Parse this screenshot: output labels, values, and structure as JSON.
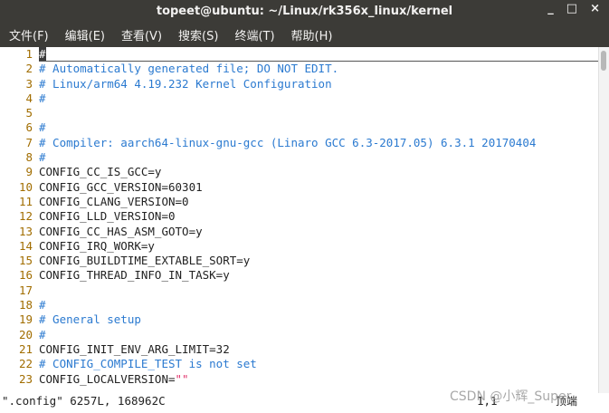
{
  "window": {
    "title": "topeet@ubuntu: ~/Linux/rk356x_linux/kernel",
    "controls": [
      "_",
      "□",
      "×"
    ]
  },
  "menu": [
    "文件(F)",
    "编辑(E)",
    "查看(V)",
    "搜索(S)",
    "终端(T)",
    "帮助(H)"
  ],
  "lines": [
    {
      "n": "1",
      "t": "#",
      "kind": "comment",
      "cursor": true
    },
    {
      "n": "2",
      "t": "# Automatically generated file; DO NOT EDIT.",
      "kind": "comment"
    },
    {
      "n": "3",
      "t": "# Linux/arm64 4.19.232 Kernel Configuration",
      "kind": "comment"
    },
    {
      "n": "4",
      "t": "#",
      "kind": "comment"
    },
    {
      "n": "5",
      "t": "",
      "kind": "code"
    },
    {
      "n": "6",
      "t": "#",
      "kind": "comment"
    },
    {
      "n": "7",
      "t": "# Compiler: aarch64-linux-gnu-gcc (Linaro GCC 6.3-2017.05) 6.3.1 20170404",
      "kind": "comment"
    },
    {
      "n": "8",
      "t": "#",
      "kind": "comment"
    },
    {
      "n": "9",
      "t": "CONFIG_CC_IS_GCC=y",
      "kind": "code"
    },
    {
      "n": "10",
      "t": "CONFIG_GCC_VERSION=60301",
      "kind": "code"
    },
    {
      "n": "11",
      "t": "CONFIG_CLANG_VERSION=0",
      "kind": "code"
    },
    {
      "n": "12",
      "t": "CONFIG_LLD_VERSION=0",
      "kind": "code"
    },
    {
      "n": "13",
      "t": "CONFIG_CC_HAS_ASM_GOTO=y",
      "kind": "code"
    },
    {
      "n": "14",
      "t": "CONFIG_IRQ_WORK=y",
      "kind": "code"
    },
    {
      "n": "15",
      "t": "CONFIG_BUILDTIME_EXTABLE_SORT=y",
      "kind": "code"
    },
    {
      "n": "16",
      "t": "CONFIG_THREAD_INFO_IN_TASK=y",
      "kind": "code"
    },
    {
      "n": "17",
      "t": "",
      "kind": "code"
    },
    {
      "n": "18",
      "t": "#",
      "kind": "comment"
    },
    {
      "n": "19",
      "t": "# General setup",
      "kind": "comment"
    },
    {
      "n": "20",
      "t": "#",
      "kind": "comment"
    },
    {
      "n": "21",
      "t": "CONFIG_INIT_ENV_ARG_LIMIT=32",
      "kind": "code"
    },
    {
      "n": "22",
      "t": "# CONFIG_COMPILE_TEST is not set",
      "kind": "comment"
    },
    {
      "n": "23",
      "t": "CONFIG_LOCALVERSION=",
      "s": "\"\"",
      "kind": "code"
    }
  ],
  "status": {
    "file": "\".config\" 6257L, 168962C",
    "position": "1,1",
    "scroll": "顶端"
  },
  "watermark": "CSDN @小辉_Super",
  "colors": {
    "line_number": "#a16d00",
    "comment": "#2b7ad0",
    "string": "#e0306a",
    "chrome": "#3c3b37"
  }
}
